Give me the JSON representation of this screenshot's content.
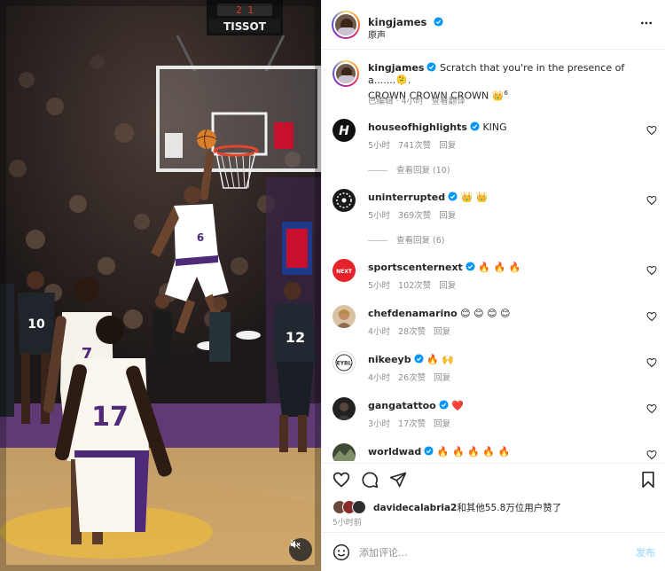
{
  "post_header": {
    "username": "kingjames",
    "audio_label": "原声",
    "more_options_icon": "more-horizontal-icon"
  },
  "video": {
    "scoreboard_brand": "TISSOT",
    "mute_icon": "speaker-muted-icon"
  },
  "caption": {
    "username": "kingjames",
    "text": "Scratch that you're in the presence of a.......🫠.",
    "text_line2": "CROWN CROWN CROWN",
    "emoji": "👑",
    "superscript": "6",
    "edited_label": "已编辑",
    "separator": "·",
    "time": "4小时",
    "translate_label": "查看翻译"
  },
  "comments": [
    {
      "username": "houseofhighlights",
      "text": "KING",
      "time": "5小时",
      "likes": "741次赞",
      "reply": "回复",
      "view_replies": "查看回复 (10)"
    },
    {
      "username": "uninterrupted",
      "text": "👑 👑",
      "time": "5小时",
      "likes": "369次赞",
      "reply": "回复",
      "view_replies": "查看回复 (6)"
    },
    {
      "username": "sportscenternext",
      "text": "🔥 🔥 🔥",
      "time": "5小时",
      "likes": "102次赞",
      "reply": "回复"
    },
    {
      "username": "chefdenamarino",
      "text": "😊 😊 😊 😊",
      "time": "4小时",
      "likes": "28次赞",
      "reply": "回复"
    },
    {
      "username": "nikeeyb",
      "text": "🔥 🙌",
      "time": "4小时",
      "likes": "26次赞",
      "reply": "回复"
    },
    {
      "username": "gangatattoo",
      "text": "❤️",
      "time": "3小时",
      "likes": "17次赞",
      "reply": "回复"
    },
    {
      "username": "worldwad",
      "text": "🔥 🔥 🔥 🔥 🔥"
    }
  ],
  "actions": {
    "like_icon": "heart-icon",
    "comment_icon": "comment-icon",
    "share_icon": "send-icon",
    "save_icon": "bookmark-icon"
  },
  "likes_summary": {
    "liker": "davidecalabria2",
    "text": "和其他55.8万位用户赞了"
  },
  "post_time": "5小时前",
  "add_comment": {
    "placeholder": "添加评论...",
    "post_label": "发布",
    "emoji_icon": "smiley-icon"
  },
  "colors": {
    "verified_blue": "#0095f6",
    "muted_text": "#8e8e8e",
    "post_button_disabled": "#b2dffc",
    "heart_red": "#ed4956"
  }
}
